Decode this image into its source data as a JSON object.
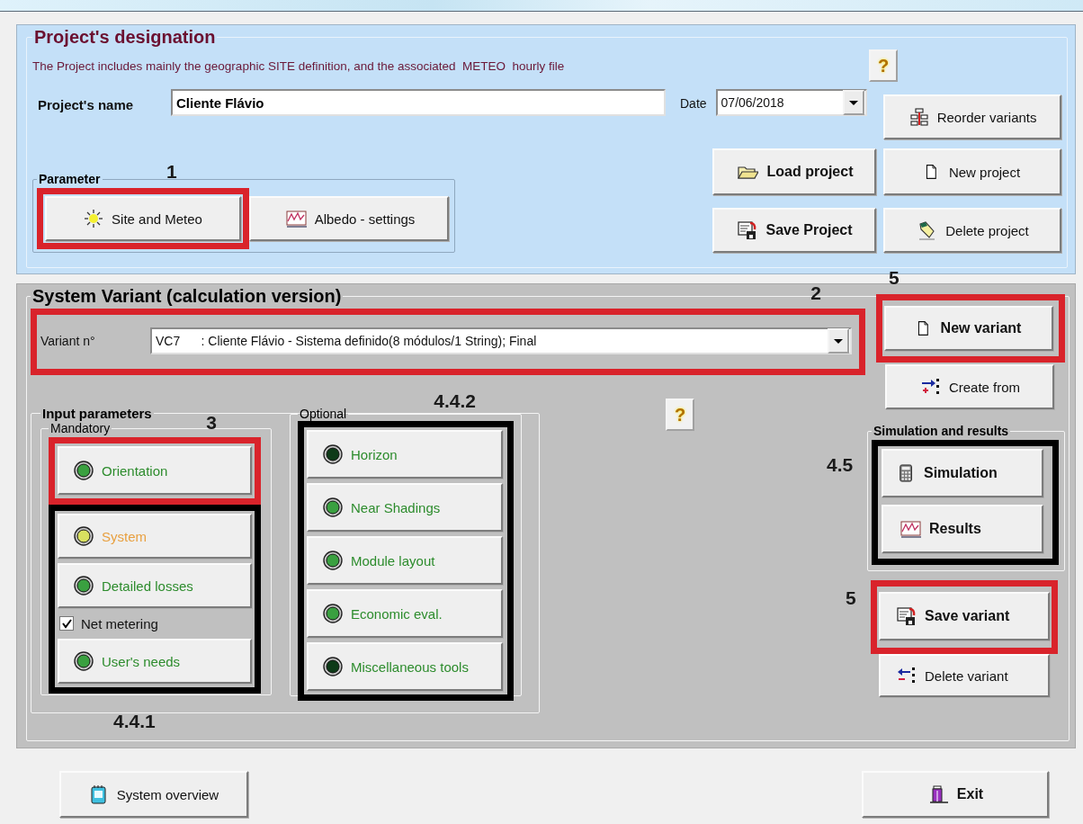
{
  "project": {
    "title": "Project's designation",
    "description": "The Project includes mainly the geographic SITE definition, and the associated  METEO  hourly file",
    "help": "?",
    "name_label": "Project's name",
    "name_value": "Cliente Flávio",
    "date_label": "Date",
    "date_value": "07/06/2018",
    "reorder_button": {
      "label": "Reorder variants"
    },
    "parameter": {
      "title": "Parameter",
      "note": "1",
      "site_button": {
        "label": "Site and Meteo",
        "highlighted": true
      },
      "albedo_button": {
        "label": "Albedo - settings"
      }
    },
    "load_button": {
      "label": "Load project"
    },
    "new_button": {
      "label": "New project"
    },
    "save_button": {
      "label": "Save Project"
    },
    "delete_button": {
      "label": "Delete project"
    }
  },
  "variant": {
    "title": "System Variant (calculation version)",
    "note": "2",
    "highlighted": true,
    "label": "Variant n°",
    "value": "VC7      : Cliente Flávio - Sistema definido(8 módulos/1 String); Final",
    "new_variant": {
      "label": "New variant",
      "note": "5",
      "highlighted": true
    },
    "create_from": {
      "label": "Create from"
    },
    "input_parameters": {
      "title": "Input parameters",
      "mandatory": {
        "title": "Mandatory",
        "note": "3",
        "bottom_note": "4.4.1",
        "blocks": [
          {
            "color": "#d9232b",
            "items": [
              {
                "kind": "button",
                "label": "Orientation",
                "color": "#3aa040",
                "incomplete": false
              }
            ]
          },
          {
            "color": "#000000",
            "items": [
              {
                "kind": "button",
                "label": "System",
                "color": "#d8e060",
                "incomplete": true
              },
              {
                "kind": "button",
                "label": "Detailed losses",
                "color": "#3aa040",
                "incomplete": false
              },
              {
                "kind": "checkbox",
                "label": "Net metering",
                "checked": true
              },
              {
                "kind": "button",
                "label": "User's needs",
                "color": "#3aa040",
                "incomplete": false
              }
            ]
          }
        ]
      },
      "optional": {
        "title": "Optional",
        "note": "4.4.2",
        "blocks": [
          {
            "color": "#000000",
            "items": [
              {
                "kind": "button",
                "label": "Horizon",
                "color": "#0e3a18",
                "incomplete": false
              },
              {
                "kind": "button",
                "label": "Near Shadings",
                "color": "#3aa040",
                "incomplete": false
              },
              {
                "kind": "button",
                "label": "Module layout",
                "color": "#3aa040",
                "incomplete": false
              },
              {
                "kind": "button",
                "label": "Economic eval.",
                "color": "#3aa040",
                "incomplete": false
              },
              {
                "kind": "button",
                "label": "Miscellaneous tools",
                "color": "#0e3a18",
                "incomplete": false
              }
            ]
          }
        ]
      }
    },
    "help": "?",
    "simulation": {
      "title": "Simulation and results",
      "note": "4.5",
      "outlined": true,
      "buttons": [
        {
          "label": "Simulation"
        },
        {
          "label": "Results"
        }
      ]
    },
    "save_variant": {
      "label": "Save variant",
      "note": "5",
      "highlighted": true
    },
    "delete_variant": {
      "label": "Delete variant"
    }
  },
  "footer": {
    "overview_button": {
      "label": "System overview"
    },
    "exit_button": {
      "label": "Exit"
    }
  }
}
